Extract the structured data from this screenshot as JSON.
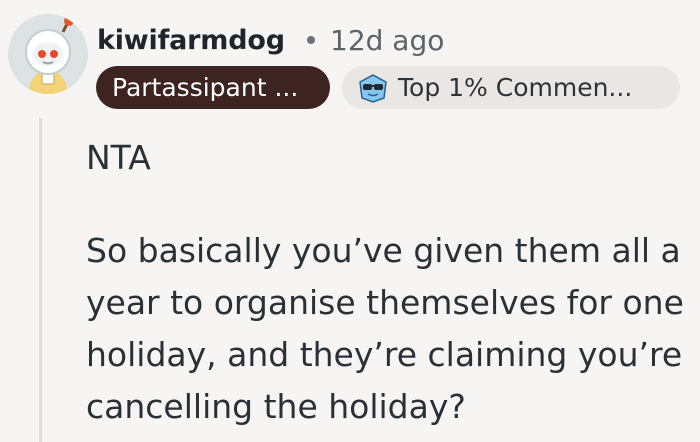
{
  "author": {
    "username": "kiwifarmdog",
    "timestamp": "12d ago",
    "flair_primary": "Partassipant ...",
    "flair_secondary": "Top 1% Commen..."
  },
  "comment": {
    "paragraphs": [
      "NTA",
      "So basically you’ve given them all a year to organise themselves for one holiday, and they’re claiming you’re cancelling the holiday?"
    ]
  },
  "icons": {
    "avatar": "snoo-astronaut-avatar",
    "flair": "sunglasses-face-icon"
  },
  "colors": {
    "background": "#f7f5f4",
    "flair_dark_bg": "#3d2420",
    "flair_light_bg": "#eae6e4"
  }
}
